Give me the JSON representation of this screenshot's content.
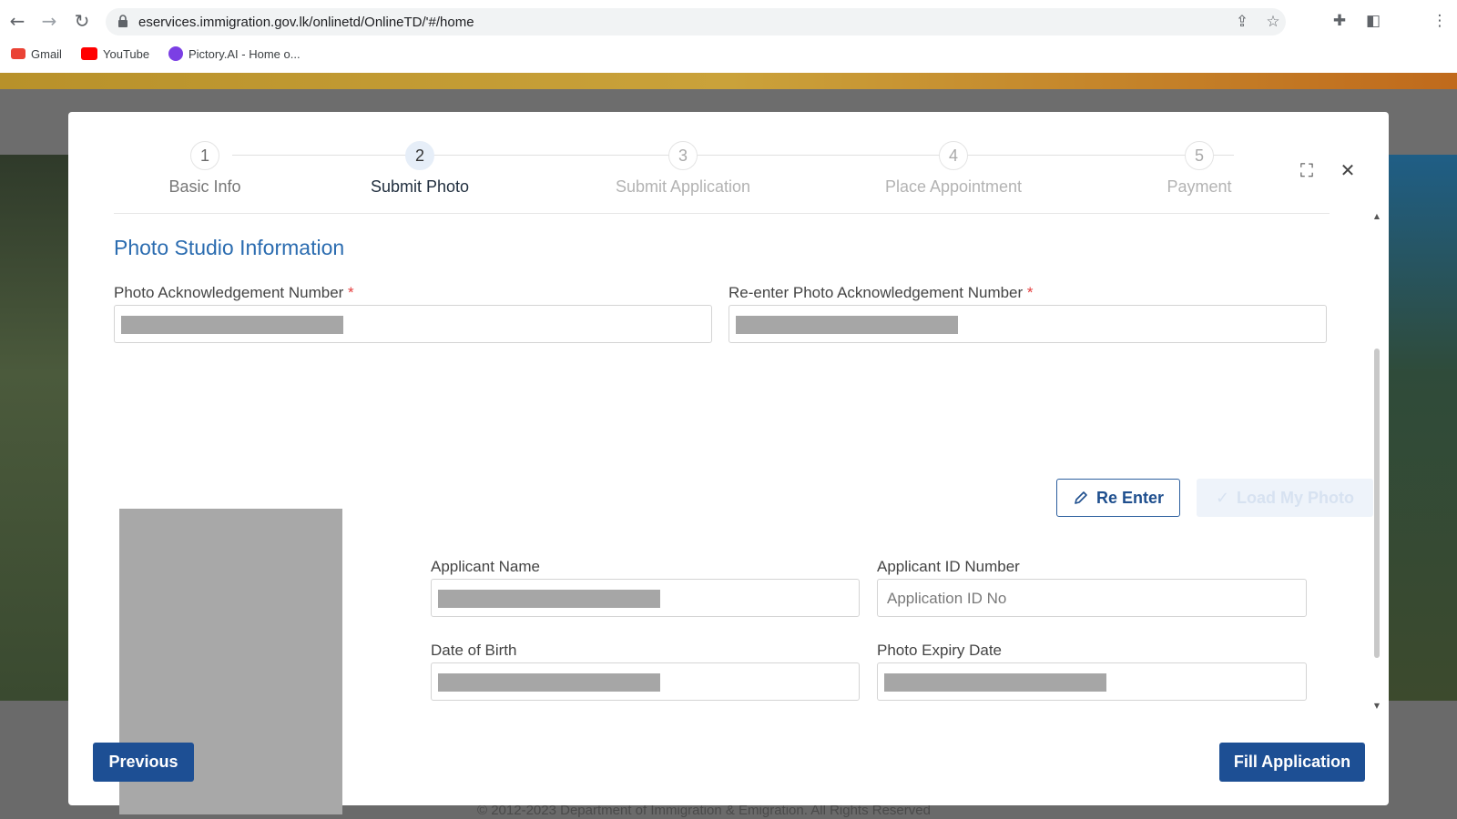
{
  "browser": {
    "url": "eservices.immigration.gov.lk/onlinetd/OnlineTD/'#/home",
    "bookmarks": [
      {
        "label": "Gmail",
        "icon": "gmail-icon",
        "color": "#ea4335"
      },
      {
        "label": "YouTube",
        "icon": "youtube-icon",
        "color": "#ff0000"
      },
      {
        "label": "Pictory.AI - Home o...",
        "icon": "pictory-icon",
        "color": "#7b3fe4"
      }
    ]
  },
  "page": {
    "footer": "© 2012-2023 Department of Immigration & Emigration. All Rights Reserved"
  },
  "modal": {
    "steps": [
      {
        "number": "1",
        "label": "Basic Info",
        "state": "done"
      },
      {
        "number": "2",
        "label": "Submit Photo",
        "state": "active"
      },
      {
        "number": "3",
        "label": "Submit Application",
        "state": "pending"
      },
      {
        "number": "4",
        "label": "Place Appointment",
        "state": "pending"
      },
      {
        "number": "5",
        "label": "Payment",
        "state": "pending"
      }
    ],
    "section_title": "Photo Studio Information",
    "fields": {
      "ack_number": {
        "label": "Photo Acknowledgement Number",
        "required": "*"
      },
      "reenter_ack_number": {
        "label": "Re-enter Photo Acknowledgement Number",
        "required": "*"
      },
      "applicant_name": {
        "label": "Applicant Name"
      },
      "applicant_id": {
        "label": "Applicant ID Number",
        "placeholder": "Application ID No"
      },
      "dob": {
        "label": "Date of Birth"
      },
      "photo_expiry": {
        "label": "Photo Expiry Date"
      }
    },
    "buttons": {
      "reenter": "Re Enter",
      "load_photo": "Load My Photo",
      "previous": "Previous",
      "fill_application": "Fill Application"
    },
    "colors": {
      "primary": "#1d4f94",
      "section_title": "#2b6cb0",
      "required": "#e53e3e"
    }
  }
}
